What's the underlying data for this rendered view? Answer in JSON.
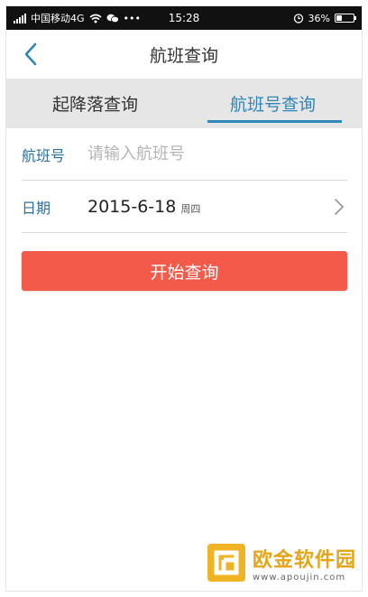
{
  "status_bar": {
    "carrier": "中国移动4G",
    "more": "•••",
    "time": "15:28",
    "battery": "36%",
    "battery_level": 0.36
  },
  "header": {
    "title": "航班查询"
  },
  "tabs": [
    {
      "label": "起降落查询",
      "active": false
    },
    {
      "label": "航班号查询",
      "active": true
    }
  ],
  "form": {
    "flight_label": "航班号",
    "flight_placeholder": "请输入航班号",
    "flight_value": "",
    "date_label": "日期",
    "date_value": "2015-6-18",
    "weekday": "周四"
  },
  "search_button": {
    "label": "开始查询"
  },
  "watermark": {
    "title": "欧金软件园",
    "url": "www.apoujin.com"
  },
  "colors": {
    "accent": "#2f86b8",
    "button": "#f45a4a",
    "tab_bg": "#e6e6e6"
  }
}
